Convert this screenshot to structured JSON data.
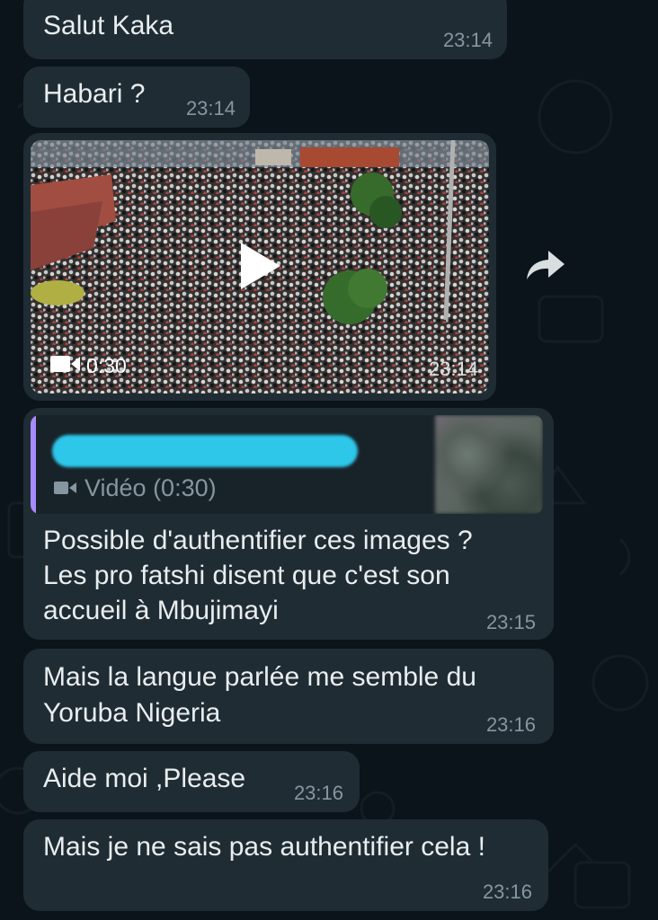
{
  "messages": [
    {
      "text": "Salut Kaka",
      "time": "23:14"
    },
    {
      "text": "Habari ?",
      "time": "23:14"
    }
  ],
  "video_message": {
    "duration": "0:30",
    "time": "23:14",
    "icons": [
      "play-icon",
      "video-camera-icon",
      "forward-icon"
    ]
  },
  "reply_message": {
    "quoted_type": "Vidéo (0:30)",
    "lines": [
      "Possible d'authentifier ces images ?",
      "Les pro fatshi disent que c'est son",
      "accueil à Mbujimayi"
    ],
    "time": "23:15"
  },
  "messages2": [
    {
      "lines": [
        "Mais la langue parlée me semble du",
        "Yoruba Nigeria"
      ],
      "time": "23:16"
    },
    {
      "text": "Aide moi ,Please",
      "time": "23:16"
    },
    {
      "text": "Mais je ne sais pas authentifier cela !",
      "time": "23:16"
    }
  ],
  "colors": {
    "background": "#0b141a",
    "bubble": "#1f2c34",
    "timestamp": "#8696a0",
    "quote_accent": "#a78bfa",
    "redaction": "#2ec7ea"
  }
}
